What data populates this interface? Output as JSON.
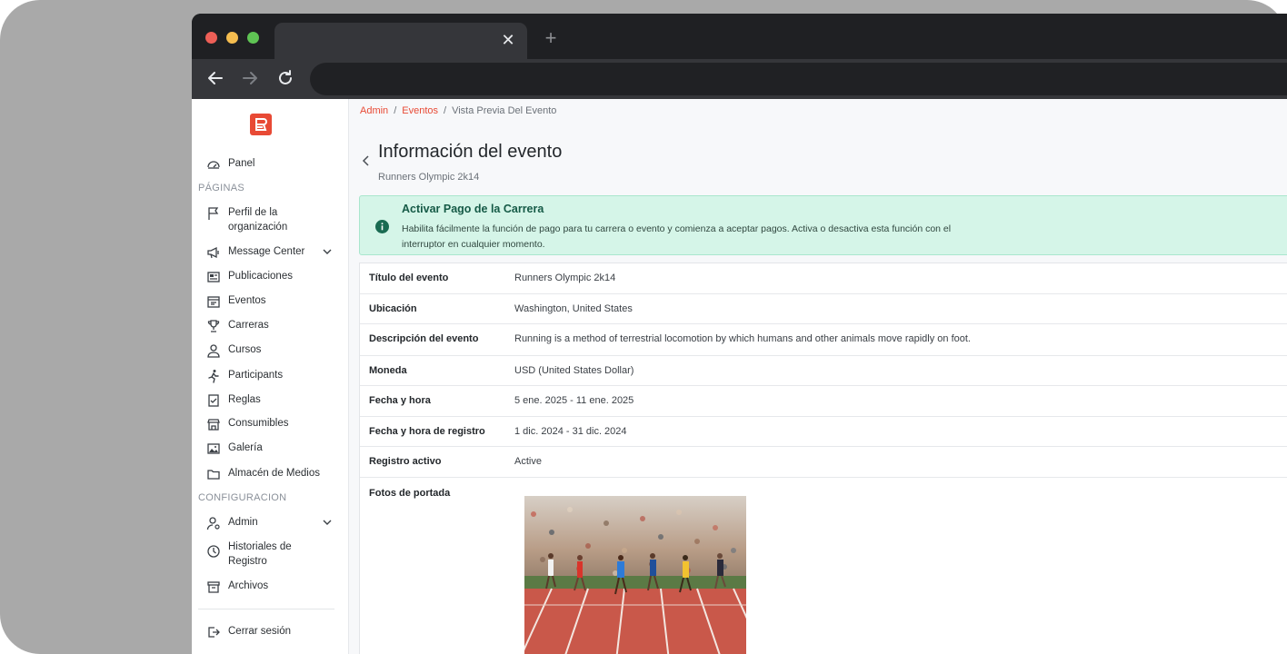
{
  "sidebar": {
    "logo_letter": "R",
    "items": [
      {
        "label": "Panel",
        "icon": "dashboard-icon"
      },
      {
        "label": "Perfil de la organización",
        "icon": "flag-icon"
      },
      {
        "label": "Message Center",
        "icon": "megaphone-icon"
      },
      {
        "label": "Publicaciones",
        "icon": "newspaper-icon"
      },
      {
        "label": "Eventos",
        "icon": "calendar-icon"
      },
      {
        "label": "Carreras",
        "icon": "trophy-icon"
      },
      {
        "label": "Cursos",
        "icon": "user-icon"
      },
      {
        "label": "Participants",
        "icon": "runner-icon"
      },
      {
        "label": "Reglas",
        "icon": "checklist-icon"
      },
      {
        "label": "Consumibles",
        "icon": "store-icon"
      },
      {
        "label": "Galería",
        "icon": "gallery-icon"
      },
      {
        "label": "Almacén de Medios",
        "icon": "folder-icon"
      },
      {
        "label": "Admin",
        "icon": "admin-icon"
      },
      {
        "label": "Historiales de Registro",
        "icon": "clock-icon"
      },
      {
        "label": "Archivos",
        "icon": "archive-icon"
      },
      {
        "label": "Cerrar sesión",
        "icon": "logout-icon"
      }
    ],
    "sections": {
      "pages": "PÁGINAS",
      "config": "CONFIGURACION"
    }
  },
  "breadcrumb": {
    "items": [
      "Admin",
      "Eventos",
      "Vista Previa Del Evento"
    ],
    "separator": "/"
  },
  "header": {
    "title": "Información del evento",
    "subtitle": "Runners Olympic 2k14"
  },
  "alert": {
    "title": "Activar Pago de la Carrera",
    "text": "Habilita fácilmente la función de pago para tu carrera o evento y comienza a aceptar pagos. Activa o desactiva esta función con el interruptor en cualquier momento."
  },
  "details": {
    "rows": [
      {
        "key": "Título del evento",
        "value": "Runners Olympic 2k14"
      },
      {
        "key": "Ubicación",
        "value": "Washington, United States"
      },
      {
        "key": "Descripción del evento",
        "value": "Running is a method of terrestrial locomotion by which humans and other animals move rapidly on foot."
      },
      {
        "key": "Moneda",
        "value": "USD (United States Dollar)"
      },
      {
        "key": "Fecha y hora",
        "value": "5 ene. 2025 - 11 ene. 2025"
      },
      {
        "key": "Fecha y hora de registro",
        "value": "1 dic. 2024 - 31 dic. 2024"
      },
      {
        "key": "Registro activo",
        "value": "Active"
      },
      {
        "key": "Fotos de portada",
        "value": ""
      }
    ]
  },
  "colors": {
    "brand": "#e84a35",
    "alert_bg": "#d5f5e8",
    "alert_title": "#155a46"
  }
}
